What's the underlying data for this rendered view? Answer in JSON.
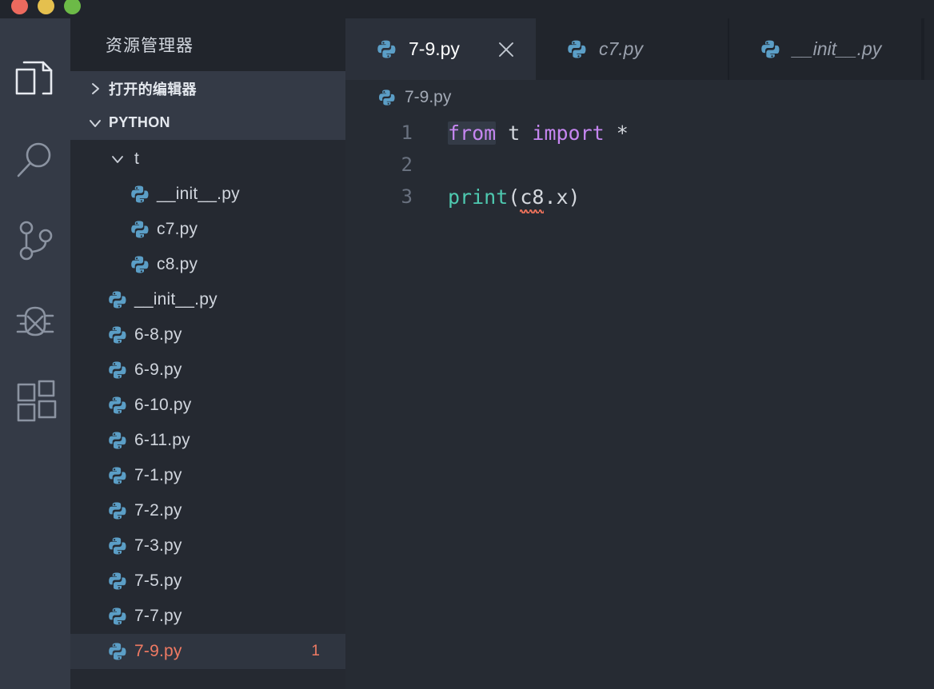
{
  "window": {
    "traffic_lights": [
      {
        "name": "close",
        "color": "#ec6a5e"
      },
      {
        "name": "minimize",
        "color": "#e5c04e"
      },
      {
        "name": "zoom",
        "color": "#6cba47"
      }
    ]
  },
  "activity_bar": {
    "items": [
      {
        "icon": "files-icon",
        "label": "资源管理器",
        "active": true
      },
      {
        "icon": "search-icon",
        "label": "搜索",
        "active": false
      },
      {
        "icon": "source-control-icon",
        "label": "源代码管理",
        "active": false
      },
      {
        "icon": "debug-icon",
        "label": "运行和调试",
        "active": false
      },
      {
        "icon": "extensions-icon",
        "label": "扩展",
        "active": false
      }
    ]
  },
  "sidebar": {
    "title": "资源管理器",
    "sections": [
      {
        "label": "打开的编辑器",
        "expanded": false,
        "chevron": "chevron-right-icon"
      },
      {
        "label": "PYTHON",
        "expanded": true,
        "chevron": "chevron-down-icon"
      }
    ],
    "tree": [
      {
        "label": "t",
        "type": "folder",
        "indent": 1,
        "expanded": true,
        "selected": false,
        "badge": ""
      },
      {
        "label": "__init__.py",
        "type": "file",
        "indent": 2,
        "selected": false,
        "badge": ""
      },
      {
        "label": "c7.py",
        "type": "file",
        "indent": 2,
        "selected": false,
        "badge": ""
      },
      {
        "label": "c8.py",
        "type": "file",
        "indent": 2,
        "selected": false,
        "badge": ""
      },
      {
        "label": "__init__.py",
        "type": "file",
        "indent": 1,
        "selected": false,
        "badge": ""
      },
      {
        "label": "6-8.py",
        "type": "file",
        "indent": 1,
        "selected": false,
        "badge": ""
      },
      {
        "label": "6-9.py",
        "type": "file",
        "indent": 1,
        "selected": false,
        "badge": ""
      },
      {
        "label": "6-10.py",
        "type": "file",
        "indent": 1,
        "selected": false,
        "badge": ""
      },
      {
        "label": "6-11.py",
        "type": "file",
        "indent": 1,
        "selected": false,
        "badge": ""
      },
      {
        "label": "7-1.py",
        "type": "file",
        "indent": 1,
        "selected": false,
        "badge": ""
      },
      {
        "label": "7-2.py",
        "type": "file",
        "indent": 1,
        "selected": false,
        "badge": ""
      },
      {
        "label": "7-3.py",
        "type": "file",
        "indent": 1,
        "selected": false,
        "badge": ""
      },
      {
        "label": "7-5.py",
        "type": "file",
        "indent": 1,
        "selected": false,
        "badge": ""
      },
      {
        "label": "7-7.py",
        "type": "file",
        "indent": 1,
        "selected": false,
        "badge": ""
      },
      {
        "label": "7-9.py",
        "type": "file",
        "indent": 1,
        "selected": true,
        "badge": "1"
      }
    ]
  },
  "editor": {
    "tabs": [
      {
        "label": "7-9.py",
        "icon": "python-file-icon",
        "active": true,
        "dirty": false,
        "close": "close-icon"
      },
      {
        "label": "c7.py",
        "icon": "python-file-icon",
        "active": false,
        "preview": true
      },
      {
        "label": "__init__.py",
        "icon": "python-file-icon",
        "active": false,
        "preview": true
      }
    ],
    "breadcrumb": {
      "icon": "python-file-icon",
      "label": "7-9.py"
    },
    "lines": [
      {
        "number": "1",
        "tokens": [
          {
            "text": "from",
            "kind": "keyword",
            "highlight": true
          },
          {
            "text": " ",
            "kind": "plain"
          },
          {
            "text": "t",
            "kind": "plain"
          },
          {
            "text": " ",
            "kind": "plain"
          },
          {
            "text": "import",
            "kind": "keyword"
          },
          {
            "text": " ",
            "kind": "plain"
          },
          {
            "text": "*",
            "kind": "plain"
          }
        ]
      },
      {
        "number": "2",
        "tokens": []
      },
      {
        "number": "3",
        "tokens": [
          {
            "text": "print",
            "kind": "function"
          },
          {
            "text": "(",
            "kind": "punct"
          },
          {
            "text": "c8",
            "kind": "plain",
            "error": true
          },
          {
            "text": ".x",
            "kind": "plain"
          },
          {
            "text": ")",
            "kind": "punct"
          }
        ]
      }
    ]
  },
  "colors": {
    "titlebar_bg": "#21252c",
    "activitybar_bg": "#343a46",
    "sidebar_bg": "#252931",
    "section_bg": "#343a46",
    "editor_bg": "#262b33",
    "tabbar_bg": "#21252c",
    "active_tab_bg": "#2b303a",
    "selected_row_bg": "#2f3540",
    "error_red": "#f07a63",
    "keyword_purple": "#c586f0",
    "function_teal": "#4ec9b0",
    "python_icon_blue": "#5b9ec6"
  }
}
